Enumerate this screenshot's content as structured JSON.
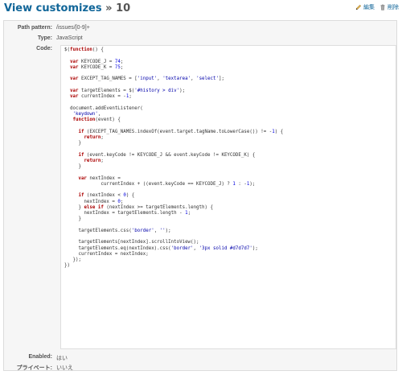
{
  "header": {
    "title_link": "View customizes",
    "title_separator": " » ",
    "title_id": "10",
    "edit_label": "編集",
    "delete_label": "削除"
  },
  "fields": {
    "path_pattern_label": "Path pattern:",
    "path_pattern_value": "/issues/[0-9]+",
    "type_label": "Type:",
    "type_value": "JavaScript",
    "code_label": "Code:",
    "enabled_label": "Enabled:",
    "enabled_value": "はい",
    "private_label": "プライベート:",
    "private_value": "いいえ"
  },
  "code_lines": [
    "$(function() {",
    "",
    "  var KEYCODE_J = 74;",
    "  var KEYCODE_K = 75;",
    "",
    "  var EXCEPT_TAG_NAMES = ['input', 'textarea', 'select'];",
    "",
    "  var targetElements = $('#history > div');",
    "  var currentIndex = -1;",
    "",
    "  document.addEventListener(",
    "   'keydown',",
    "   function(event) {",
    "",
    "     if (EXCEPT_TAG_NAMES.indexOf(event.target.tagName.toLowerCase()) != -1) {",
    "       return;",
    "     }",
    "",
    "     if (event.keyCode != KEYCODE_J && event.keyCode != KEYCODE_K) {",
    "       return;",
    "     }",
    "",
    "     var nextIndex =",
    "             currentIndex + ((event.keyCode == KEYCODE_J) ? 1 : -1);",
    "",
    "     if (nextIndex < 0) {",
    "       nextIndex = 0;",
    "     } else if (nextIndex >= targetElements.length) {",
    "       nextIndex = targetElements.length - 1;",
    "     }",
    "",
    "     targetElements.css('border', '');",
    "",
    "     targetElements[nextIndex].scrollIntoView();",
    "     targetElements.eq(nextIndex).css('border', '3px solid #d7d7d7');",
    "     currentIndex = nextIndex;",
    "   });",
    "})"
  ],
  "colors": {
    "link": "#116699",
    "keyword": "#aa0000",
    "number": "#0000dd",
    "string": "#0000aa",
    "box_background": "#f6f6f6"
  }
}
